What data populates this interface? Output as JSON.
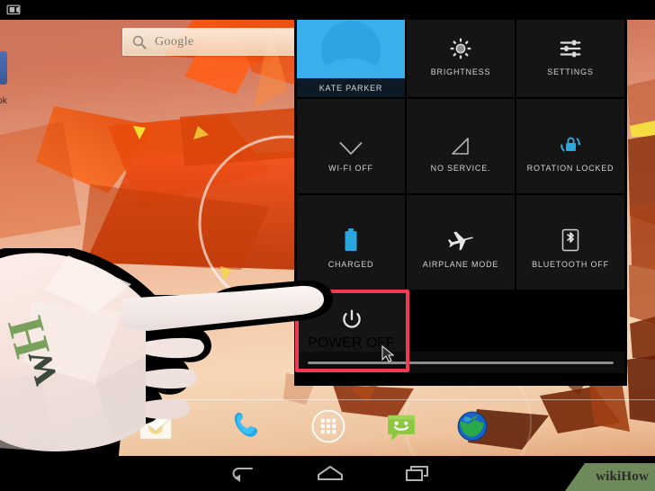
{
  "status_bar": {
    "screenshot_icon": "camera-screenshot-icon"
  },
  "home_screen": {
    "search": {
      "icon": "search-magnifier-icon",
      "text": "Google"
    },
    "left_app": {
      "label": "ok",
      "icon": "facebook-icon"
    },
    "dock": [
      {
        "name": "email-icon",
        "label": "Email"
      },
      {
        "name": "phone-icon",
        "label": "Phone"
      },
      {
        "name": "app-drawer-icon",
        "label": "Apps"
      },
      {
        "name": "messaging-icon",
        "label": "Messaging"
      },
      {
        "name": "browser-icon",
        "label": "Browser"
      }
    ],
    "nav": [
      {
        "name": "back-button",
        "label": "Back"
      },
      {
        "name": "home-button",
        "label": "Home"
      },
      {
        "name": "recents-button",
        "label": "Recent apps"
      }
    ]
  },
  "quick_settings": {
    "tiles": [
      {
        "id": "user",
        "icon": "user-avatar-icon",
        "label": "KATE PARKER"
      },
      {
        "id": "brightness",
        "icon": "brightness-gear-icon",
        "label": "BRIGHTNESS"
      },
      {
        "id": "settings",
        "icon": "settings-sliders-icon",
        "label": "SETTINGS"
      },
      {
        "id": "wifi",
        "icon": "wifi-off-icon",
        "label": "WI-FI OFF"
      },
      {
        "id": "signal",
        "icon": "no-signal-icon",
        "label": "NO SERVICE."
      },
      {
        "id": "rotation",
        "icon": "rotation-lock-icon",
        "label": "ROTATION LOCKED"
      },
      {
        "id": "battery",
        "icon": "battery-full-icon",
        "label": "CHARGED"
      },
      {
        "id": "airplane",
        "icon": "airplane-icon",
        "label": "AIRPLANE MODE"
      },
      {
        "id": "bluetooth",
        "icon": "bluetooth-off-icon",
        "label": "BLUETOOTH OFF"
      }
    ],
    "power_tile": {
      "icon": "power-off-icon",
      "label": "POWER OFF"
    },
    "handle": "drag-handle",
    "highlight_color": "#ef3b52",
    "accent_color": "#3bafec"
  },
  "watermark": {
    "text": "wikiHow",
    "background_color": "#6f8a5a"
  },
  "hand_overlay": {
    "logo_letters": "wH",
    "name": "pointing-hand-illustration"
  }
}
